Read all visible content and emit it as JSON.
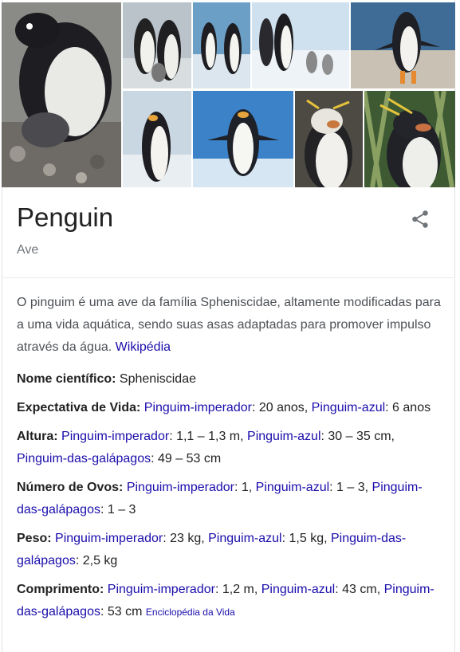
{
  "entity": {
    "title": "Penguin",
    "subtitle": "Ave"
  },
  "description": {
    "text": "O pinguim é uma ave da família Spheniscidae, altamente modificadas para a uma vida aquática, sendo suas asas adaptadas para promover impulso através da água.",
    "source_link": "Wikipédia"
  },
  "facts": {
    "scientific_name": {
      "label": "Nome científico:",
      "value": "Spheniscidae"
    },
    "lifespan": {
      "label": "Expectativa de Vida:",
      "link1": "Pinguim-imperador",
      "val1": ": 20 anos, ",
      "link2": "Pinguim-azul",
      "val2": ": 6 anos"
    },
    "height": {
      "label": "Altura:",
      "link1": "Pinguim-imperador",
      "val1": ": 1,1 – 1,3 m, ",
      "link2": "Pinguim-azul",
      "val2": ": 30 – 35 cm, ",
      "link3": "Pinguim-das-galápagos",
      "val3": ": 49 – 53 cm"
    },
    "eggs": {
      "label": "Número de Ovos:",
      "link1": "Pinguim-imperador",
      "val1": ": 1, ",
      "link2": "Pinguim-azul",
      "val2": ": 1 – 3, ",
      "link3": "Pinguim-das-galápagos",
      "val3": ": 1 – 3"
    },
    "weight": {
      "label": "Peso:",
      "link1": "Pinguim-imperador",
      "val1": ": 23 kg, ",
      "link2": "Pinguim-azul",
      "val2": ": 1,5 kg, ",
      "link3": "Pinguim-das-galápagos",
      "val3": ": 2,5 kg"
    },
    "length": {
      "label": "Comprimento:",
      "link1": "Pinguim-imperador",
      "val1": ": 1,2 m, ",
      "link2": "Pinguim-azul",
      "val2": ": 43 cm, ",
      "link3": "Pinguim-das-galápagos",
      "val3": ": 53 cm",
      "source": "Enciclopédia da Vida"
    }
  },
  "icons": {
    "share": "share-icon"
  },
  "colors": {
    "link": "#1a0dab",
    "muted": "#70757a",
    "text": "#222222"
  }
}
